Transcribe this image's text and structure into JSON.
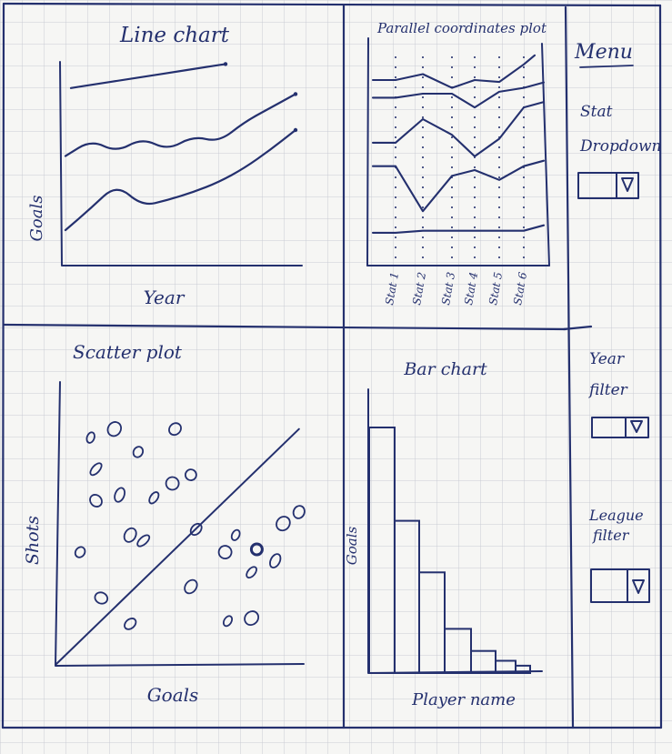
{
  "line_chart": {
    "title": "Line chart",
    "xlabel": "Year",
    "ylabel": "Goals"
  },
  "parallel_plot": {
    "title": "Parallel coordinates plot",
    "axes": [
      "Stat 1",
      "Stat 2",
      "Stat 3",
      "Stat 4",
      "Stat 5",
      "Stat 6"
    ]
  },
  "menu": {
    "title": "Menu",
    "stat_dropdown_label_line1": "Stat",
    "stat_dropdown_label_line2": "Dropdown",
    "year_filter_label_line1": "Year",
    "year_filter_label_line2": "filter",
    "league_filter_label_line1": "League",
    "league_filter_label_line2": "filter"
  },
  "scatter_plot": {
    "title": "Scatter plot",
    "xlabel": "Goals",
    "ylabel": "Shots"
  },
  "bar_chart": {
    "title": "Bar chart",
    "xlabel": "Player name",
    "ylabel": "Goals"
  },
  "chart_data": [
    {
      "type": "line",
      "title": "Line chart",
      "xlabel": "Year",
      "ylabel": "Goals",
      "series": [
        {
          "values": [
            8.6,
            8.8,
            9.0,
            9.2,
            9.4,
            9.6,
            9.8
          ]
        },
        {
          "values": [
            5.2,
            6.0,
            5.4,
            6.1,
            5.5,
            6.2,
            5.9,
            6.9,
            7.6,
            8.3
          ]
        },
        {
          "values": [
            1.5,
            2.6,
            3.8,
            2.7,
            3.0,
            3.4,
            3.9,
            4.6,
            5.5,
            6.5
          ]
        }
      ]
    },
    {
      "type": "line",
      "title": "Parallel coordinates plot",
      "categories": [
        "Stat 1",
        "Stat 2",
        "Stat 3",
        "Stat 4",
        "Stat 5",
        "Stat 6"
      ],
      "series": [
        {
          "values": [
            9.2,
            9.5,
            8.8,
            9.2,
            9.1,
            10.0
          ]
        },
        {
          "values": [
            8.3,
            8.5,
            8.5,
            7.8,
            8.6,
            8.8
          ]
        },
        {
          "values": [
            6.0,
            7.2,
            6.4,
            5.3,
            6.2,
            7.8
          ]
        },
        {
          "values": [
            4.8,
            2.5,
            4.3,
            4.6,
            4.1,
            4.8
          ]
        },
        {
          "values": [
            1.4,
            1.5,
            1.5,
            1.5,
            1.5,
            1.5
          ]
        }
      ]
    },
    {
      "type": "scatter",
      "title": "Scatter plot",
      "xlabel": "Goals",
      "ylabel": "Shots",
      "points": [
        [
          1.3,
          7.9
        ],
        [
          2.2,
          8.2
        ],
        [
          4.5,
          8.2
        ],
        [
          3.1,
          7.4
        ],
        [
          1.5,
          6.8
        ],
        [
          4.4,
          6.3
        ],
        [
          5.1,
          6.6
        ],
        [
          2.4,
          5.9
        ],
        [
          3.7,
          5.8
        ],
        [
          1.5,
          5.7
        ],
        [
          2.8,
          4.5
        ],
        [
          5.3,
          4.7
        ],
        [
          6.8,
          4.5
        ],
        [
          8.6,
          4.9
        ],
        [
          9.2,
          5.3
        ],
        [
          0.9,
          3.9
        ],
        [
          3.3,
          4.3
        ],
        [
          6.4,
          3.9
        ],
        [
          7.6,
          4.0
        ],
        [
          8.3,
          3.6
        ],
        [
          7.4,
          3.2
        ],
        [
          1.7,
          2.3
        ],
        [
          5.1,
          2.7
        ],
        [
          2.8,
          1.4
        ],
        [
          6.5,
          1.5
        ],
        [
          7.4,
          1.6
        ]
      ],
      "trend": [
        [
          0,
          0
        ],
        [
          9.2,
          8.2
        ]
      ]
    },
    {
      "type": "bar",
      "title": "Bar chart",
      "xlabel": "Player name",
      "ylabel": "Goals",
      "values": [
        10.0,
        6.2,
        4.1,
        1.8,
        0.9,
        0.5,
        0.3
      ]
    }
  ]
}
